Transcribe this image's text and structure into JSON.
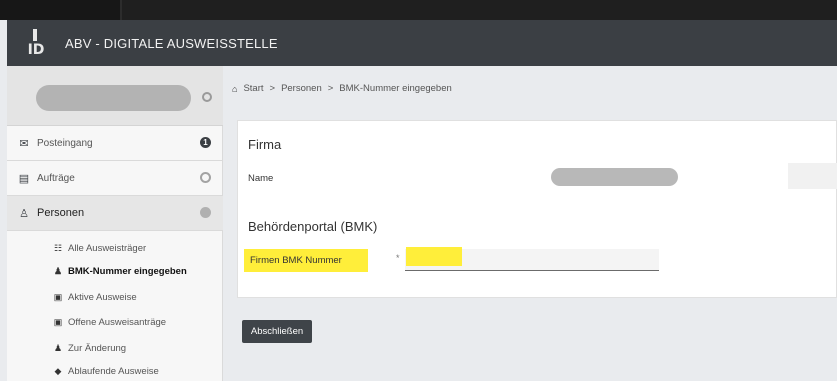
{
  "app": {
    "title": "ABV - DIGITALE AUSWEISSTELLE",
    "logo_text": "ID"
  },
  "sidebar": {
    "items": [
      {
        "label": "Posteingang",
        "icon": "envelope-icon",
        "indicator": "1"
      },
      {
        "label": "Aufträge",
        "icon": "document-icon",
        "indicator": ""
      },
      {
        "label": "Personen",
        "icon": "person-icon",
        "indicator": ""
      }
    ],
    "subitems": [
      {
        "label": "Alle Ausweisträger",
        "icon": "group-icon"
      },
      {
        "label": "BMK-Nummer eingegeben",
        "icon": "user-plus-icon"
      },
      {
        "label": "Aktive Ausweise",
        "icon": "card-icon"
      },
      {
        "label": "Offene Ausweisanträge",
        "icon": "card-icon"
      },
      {
        "label": "Zur Änderung",
        "icon": "user-edit-icon"
      },
      {
        "label": "Ablaufende Ausweise",
        "icon": "warning-card-icon"
      }
    ]
  },
  "breadcrumb": {
    "items": [
      "Start",
      "Personen",
      "BMK-Nummer eingegeben"
    ],
    "separator": ">"
  },
  "form": {
    "section_firma": "Firma",
    "name_label": "Name",
    "section_bmk": "Behördenportal (BMK)",
    "bmk_label": "Firmen BMK Nummer",
    "required_marker": "*",
    "bmk_value": ""
  },
  "actions": {
    "submit_label": "Abschließen"
  },
  "colors": {
    "header_bg": "#3b3f44",
    "highlight": "#ffee3a",
    "button_bg": "#3f4449"
  }
}
